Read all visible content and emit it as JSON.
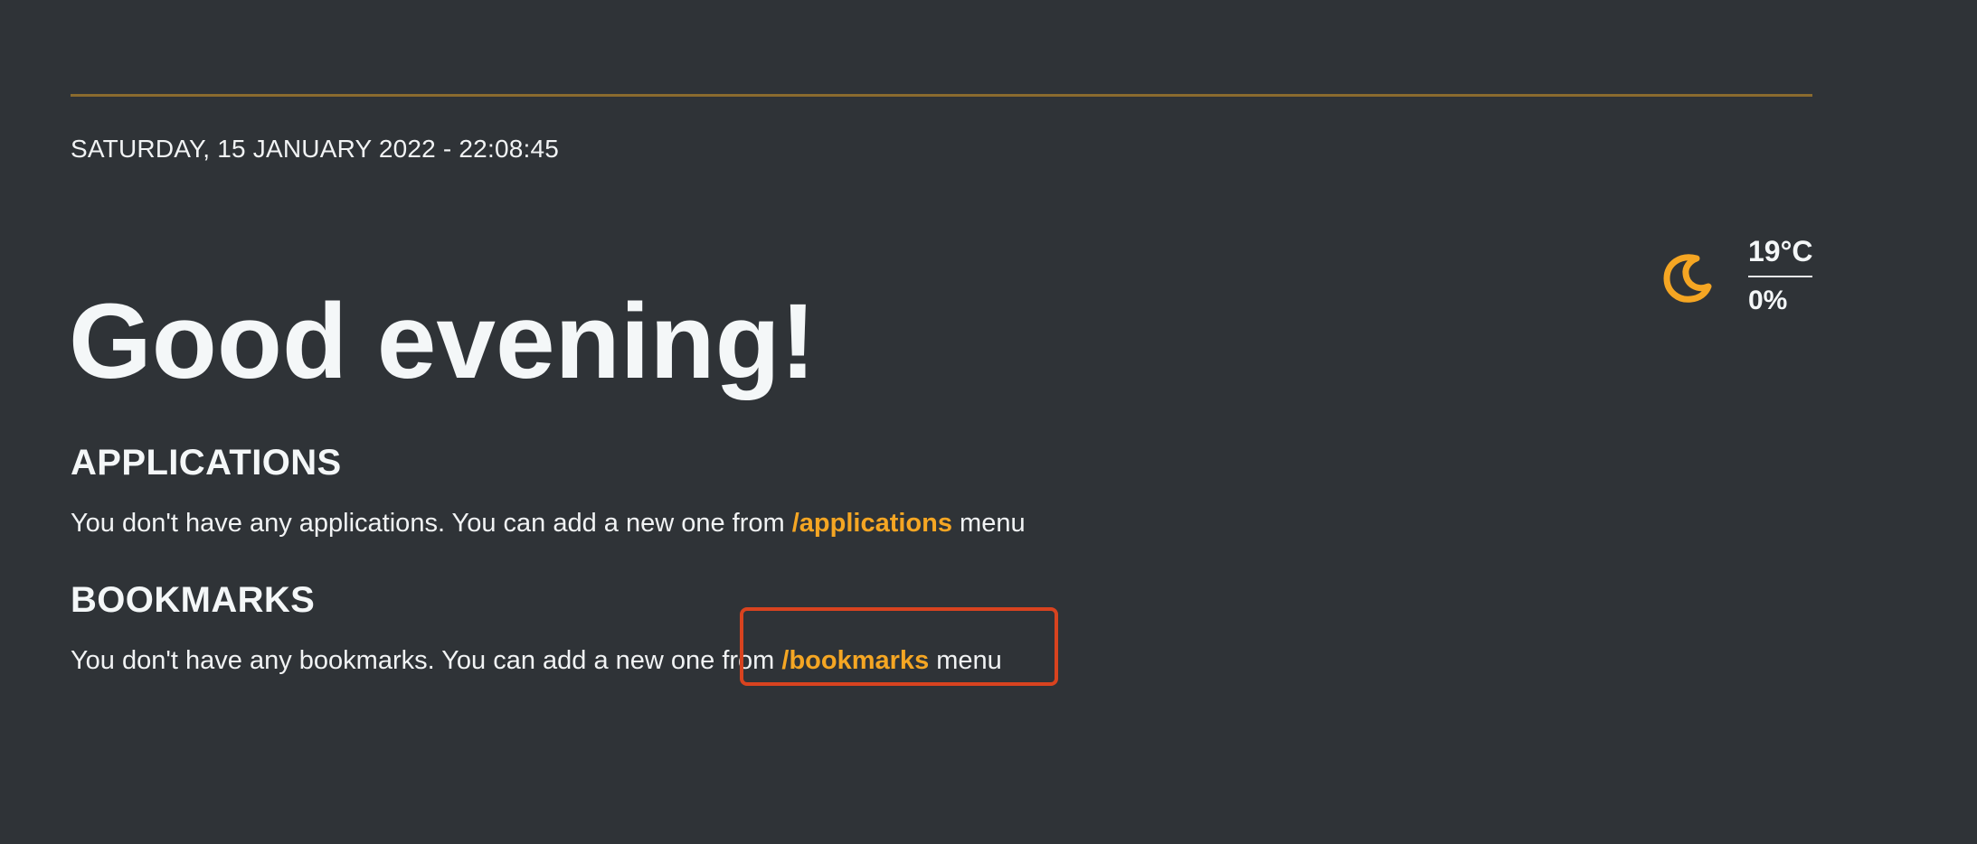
{
  "header": {
    "date_time": "SATURDAY, 15 JANUARY 2022 - 22:08:45",
    "greeting": "Good evening!"
  },
  "weather": {
    "icon": "crescent-moon-icon",
    "temperature": "19°C",
    "humidity": "0%",
    "icon_color": "#f5a623"
  },
  "applications": {
    "title": "APPLICATIONS",
    "message_prefix": "You don't have any applications. You can add a new one from ",
    "link_label": "/applications",
    "message_suffix": " menu"
  },
  "bookmarks": {
    "title": "BOOKMARKS",
    "message_prefix": "You don't have any bookmarks. You can add a new one from ",
    "link_label": "/bookmarks",
    "message_suffix": " menu"
  },
  "colors": {
    "background": "#2f3337",
    "accent": "#f5a623",
    "annotation": "#d8431f",
    "rule": "#8b6b2e"
  }
}
